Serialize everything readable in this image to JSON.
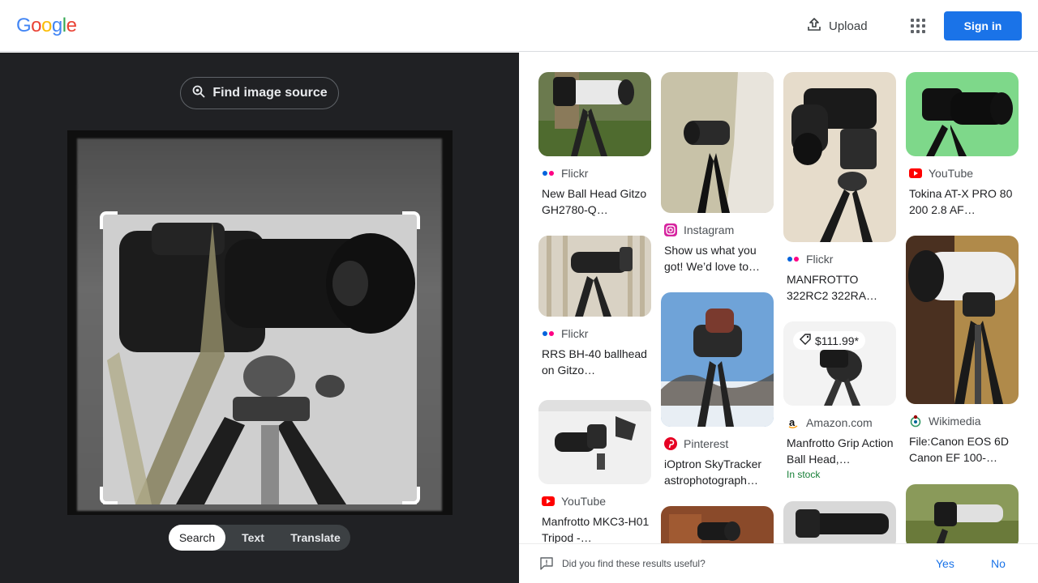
{
  "header": {
    "logo_letters": [
      {
        "ch": "G",
        "color": "#4285F4"
      },
      {
        "ch": "o",
        "color": "#EA4335"
      },
      {
        "ch": "o",
        "color": "#FBBC05"
      },
      {
        "ch": "g",
        "color": "#4285F4"
      },
      {
        "ch": "l",
        "color": "#34A853"
      },
      {
        "ch": "e",
        "color": "#EA4335"
      }
    ],
    "upload_label": "Upload",
    "signin_label": "Sign in"
  },
  "lens": {
    "find_source_label": "Find image source",
    "tabs": [
      {
        "label": "Search",
        "active": true
      },
      {
        "label": "Text",
        "active": false
      },
      {
        "label": "Translate",
        "active": false
      }
    ]
  },
  "results": {
    "columns": [
      [
        {
          "source": "Flickr",
          "source_icon": "flickr-icon",
          "title": "New Ball Head Gitzo GH2780-Q…"
        },
        {
          "source": "Flickr",
          "source_icon": "flickr-icon",
          "title": "RRS BH-40 ballhead on Gitzo…"
        },
        {
          "source": "YouTube",
          "source_icon": "youtube-icon",
          "title": "Manfrotto MKC3-H01 Tripod -…"
        }
      ],
      [
        {
          "source": "Instagram",
          "source_icon": "instagram-icon",
          "title": "Show us what you got! We’d love to…"
        },
        {
          "source": "Pinterest",
          "source_icon": "pinterest-icon",
          "title": "iOptron SkyTracker astrophotograph…"
        },
        {
          "source": "",
          "source_icon": "",
          "title": ""
        }
      ],
      [
        {
          "source": "Flickr",
          "source_icon": "flickr-icon",
          "title": "MANFROTTO 322RC2 322RA…"
        },
        {
          "source": "Amazon.com",
          "source_icon": "amazon-icon",
          "title": "Manfrotto Grip Action Ball Head,…",
          "price": "$111.99*",
          "stock": "In stock"
        },
        {
          "source": "",
          "source_icon": "",
          "title": ""
        }
      ],
      [
        {
          "source": "YouTube",
          "source_icon": "youtube-icon",
          "title": "Tokina AT-X PRO 80 200 2.8 AF…"
        },
        {
          "source": "Wikimedia",
          "source_icon": "wikimedia-icon",
          "title": "File:Canon EOS 6D Canon EF 100-…"
        },
        {
          "source": "",
          "source_icon": "",
          "title": ""
        }
      ]
    ]
  },
  "feedback": {
    "question": "Did you find these results useful?",
    "yes_label": "Yes",
    "no_label": "No"
  },
  "colors": {
    "accent": "#1a73e8",
    "dark_pane": "#202124",
    "in_stock": "#188038"
  }
}
